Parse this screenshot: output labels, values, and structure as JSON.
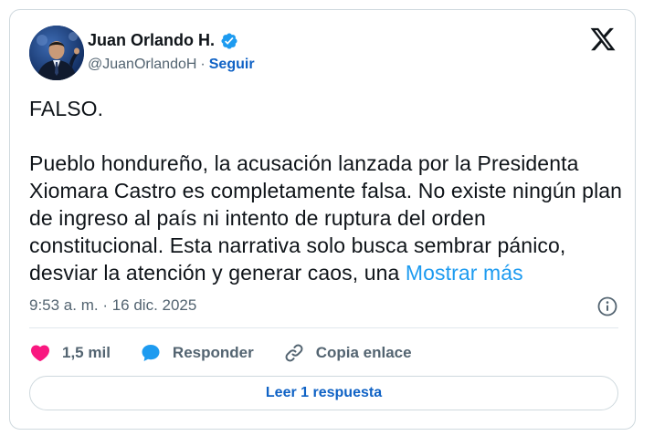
{
  "author": {
    "name": "Juan Orlando H.",
    "handle": "@JuanOrlandoH",
    "separator": "·",
    "follow_label": "Seguir"
  },
  "tweet": {
    "line1": "FALSO.",
    "body": "Pueblo hondureño, la acusación lanzada por la Presidenta Xiomara Castro es completamente falsa. No existe ningún plan de ingreso al país ni intento de ruptura del orden constitucional. Esta narrativa solo busca sembrar pánico, desviar la atención y generar caos, una",
    "show_more": "Mostrar más"
  },
  "meta": {
    "timestamp": "9:53 a. m. · 16 dic. 2025"
  },
  "actions": {
    "like_count": "1,5 mil",
    "reply_label": "Responder",
    "copy_label": "Copia enlace"
  },
  "footer": {
    "read_reply_label": "Leer 1 respuesta"
  },
  "colors": {
    "link": "#1d9bf0",
    "follow": "#0f62c5",
    "heart": "#f91880",
    "verified": "#1d9bf0",
    "muted": "#536471"
  },
  "icons": [
    "verified-badge-icon",
    "x-logo-icon",
    "info-icon",
    "heart-icon",
    "reply-bubble-icon",
    "link-icon"
  ]
}
